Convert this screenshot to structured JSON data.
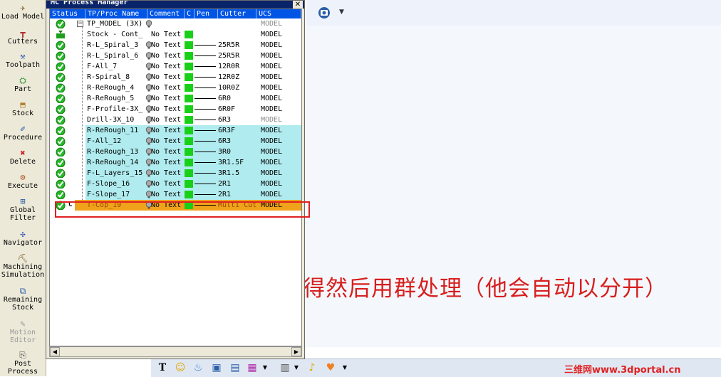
{
  "window": {
    "title": "MC Process Manager",
    "close_label": "✕"
  },
  "left_toolbar": {
    "items": [
      {
        "label": "Load Model",
        "icon": "load-model-icon"
      },
      {
        "label": "Cutters",
        "icon": "cutters-icon"
      },
      {
        "label": "Toolpath",
        "icon": "toolpath-icon"
      },
      {
        "label": "Part",
        "icon": "part-icon"
      },
      {
        "label": "Stock",
        "icon": "stock-icon"
      },
      {
        "label": "Procedure",
        "icon": "procedure-icon"
      },
      {
        "label": "Delete",
        "icon": "delete-icon"
      },
      {
        "label": "Execute",
        "icon": "execute-icon"
      },
      {
        "label": "Global",
        "label2": "Filter",
        "icon": "global-filter-icon"
      },
      {
        "label": "Navigator",
        "icon": "navigator-icon"
      },
      {
        "label": "Machining",
        "label2": "Simulation",
        "icon": "machining-simulation-icon"
      },
      {
        "label": "Remaining",
        "label2": "Stock",
        "icon": "remaining-stock-icon"
      },
      {
        "label": "Motion",
        "label2": "Editor",
        "icon": "motion-editor-icon"
      },
      {
        "label": "Post",
        "label2": "Process",
        "icon": "post-process-icon"
      }
    ]
  },
  "columns": [
    "Status",
    "TP/Proc Name",
    "Comment",
    "C",
    "Pen",
    "Cutter",
    "UCS"
  ],
  "rows": [
    {
      "name": "TP_MODEL (3X)",
      "comment": "",
      "cutter": "",
      "ucs": "MODEL",
      "status": "check",
      "color": false,
      "pen": false,
      "bulb": true,
      "expander": true
    },
    {
      "name": "Stock - Cont_",
      "comment": "No Text",
      "cutter": "",
      "ucs": "MODEL",
      "status": "stock",
      "color": true,
      "pen": false,
      "bulb": false
    },
    {
      "name": "R-L_Spiral_3",
      "comment": "No Text",
      "cutter": "25R5R",
      "ucs": "MODEL",
      "status": "check",
      "color": true,
      "pen": true,
      "bulb": true
    },
    {
      "name": "R-L_Spiral_6",
      "comment": "No Text",
      "cutter": "25R5R",
      "ucs": "MODEL",
      "status": "check",
      "color": true,
      "pen": true,
      "bulb": true
    },
    {
      "name": "F-All_7",
      "comment": "No Text",
      "cutter": "12R0R",
      "ucs": "MODEL",
      "status": "check",
      "color": true,
      "pen": true,
      "bulb": true
    },
    {
      "name": "R-Spiral_8",
      "comment": "No Text",
      "cutter": "12R0Z",
      "ucs": "MODEL",
      "status": "check",
      "color": true,
      "pen": true,
      "bulb": true
    },
    {
      "name": "R-ReRough_4",
      "comment": "No Text",
      "cutter": "10R0Z",
      "ucs": "MODEL",
      "status": "check",
      "color": true,
      "pen": true,
      "bulb": true
    },
    {
      "name": "R-ReRough_5",
      "comment": "No Text",
      "cutter": "6R0",
      "ucs": "MODEL",
      "status": "check",
      "color": true,
      "pen": true,
      "bulb": true
    },
    {
      "name": "F-Profile-3X_",
      "comment": "No Text",
      "cutter": "6R0F",
      "ucs": "MODEL",
      "status": "check",
      "color": true,
      "pen": true,
      "bulb": true
    },
    {
      "name": "Drill-3X_10",
      "comment": "No Text",
      "cutter": "6R3",
      "ucs": "MODEL",
      "status": "check",
      "color": true,
      "pen": true,
      "bulb": true
    },
    {
      "name": "R-ReRough_11",
      "comment": "No Text",
      "cutter": "6R3F",
      "ucs": "MODEL",
      "status": "check",
      "color": true,
      "pen": true,
      "bulb": true,
      "highlight": true
    },
    {
      "name": "F-All_12",
      "comment": "No Text",
      "cutter": "6R3",
      "ucs": "MODEL",
      "status": "check",
      "color": true,
      "pen": true,
      "bulb": true,
      "highlight": true
    },
    {
      "name": "R-ReRough_13",
      "comment": "No Text",
      "cutter": "3R0",
      "ucs": "MODEL",
      "status": "check",
      "color": true,
      "pen": true,
      "bulb": true,
      "highlight": true
    },
    {
      "name": "R-ReRough_14",
      "comment": "No Text",
      "cutter": "3R1.5F",
      "ucs": "MODEL",
      "status": "check",
      "color": true,
      "pen": true,
      "bulb": true,
      "highlight": true
    },
    {
      "name": "F-L_Layers_15",
      "comment": "No Text",
      "cutter": "3R1.5",
      "ucs": "MODEL",
      "status": "check",
      "color": true,
      "pen": true,
      "bulb": true,
      "highlight": true
    },
    {
      "name": "F-Slope_16",
      "comment": "No Text",
      "cutter": "2R1",
      "ucs": "MODEL",
      "status": "check",
      "color": true,
      "pen": true,
      "bulb": true,
      "highlight": true
    },
    {
      "name": "F-Slope_17",
      "comment": "No Text",
      "cutter": "2R1",
      "ucs": "MODEL",
      "status": "check",
      "color": true,
      "pen": true,
      "bulb": true,
      "highlight": true
    },
    {
      "name": "T-Cop_19",
      "comment": "No Text",
      "cutter": "Multi Cut",
      "ucs": "MODEL",
      "status": "check",
      "color": true,
      "pen": true,
      "bulb": true,
      "current": true,
      "marker": "C"
    }
  ],
  "caption": "直接选转换好得然后用群处理（他会自动以分开）",
  "watermark": "三维网www.3dportal.cn",
  "colors": {
    "selected_row": "#f0a21a",
    "highlight_row": "#b0ecef",
    "header": "#0055e5",
    "swatch": "#18d018",
    "annotation": "#e02020"
  }
}
